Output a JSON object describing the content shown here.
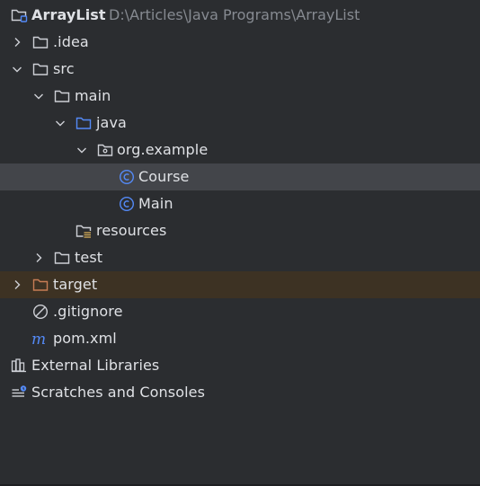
{
  "project": {
    "name": "ArrayList",
    "path": "D:\\Articles\\Java Programs\\ArrayList"
  },
  "tree": {
    "idea": ".idea",
    "src": "src",
    "main": "main",
    "java": "java",
    "package": "org.example",
    "course": "Course",
    "main_class": "Main",
    "resources": "resources",
    "test": "test",
    "target": "target",
    "gitignore": ".gitignore",
    "pom": "pom.xml",
    "external_libraries": "External Libraries",
    "scratches": "Scratches and Consoles"
  },
  "icons": {
    "folder": "folder-icon",
    "source-folder": "source-folder-icon",
    "package": "package-icon",
    "class": "java-class-icon",
    "resources": "resources-folder-icon",
    "gitignore": "ignored-file-icon",
    "maven": "maven-icon",
    "libraries": "libraries-icon",
    "scratches": "scratches-icon"
  },
  "colors": {
    "background": "#2b2d30",
    "selection": "#43454a",
    "excluded": "#3d3223",
    "text": "#dfe1e5",
    "path_text": "#868a91",
    "source_folder_blue": "#548af7",
    "excluded_orange": "#c77d55",
    "class_blue": "#548af7"
  }
}
